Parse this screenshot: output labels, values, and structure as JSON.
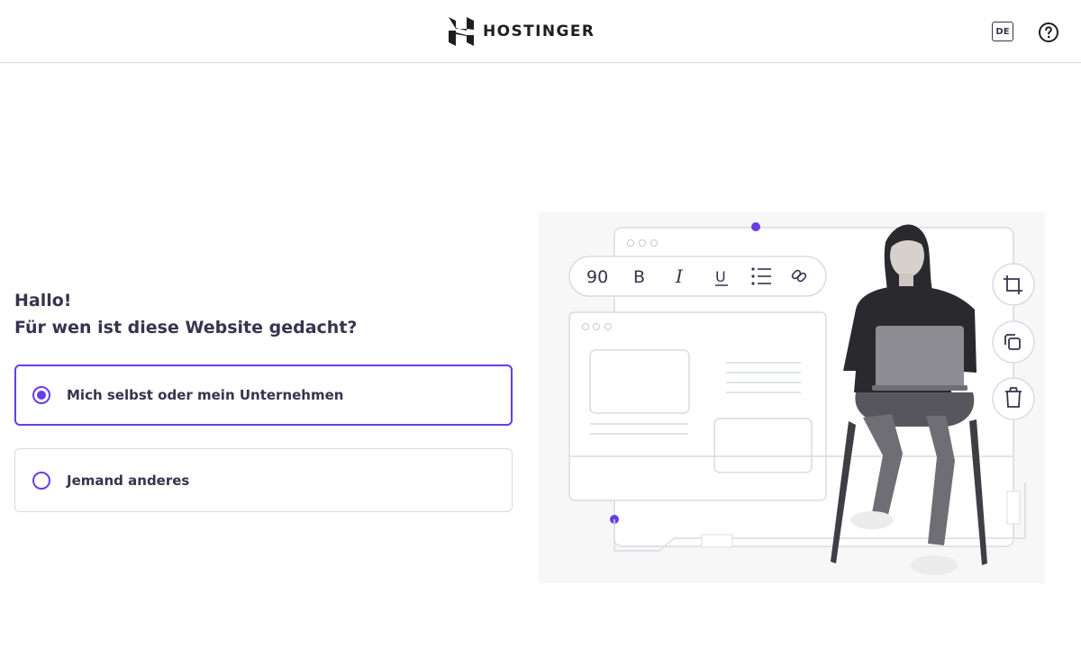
{
  "header": {
    "brand": "HOSTINGER",
    "language": "DE"
  },
  "main": {
    "greeting": "Hallo!",
    "question": "Für wen ist diese Website gedacht?",
    "options": [
      {
        "label": "Mich selbst oder mein Unternehmen",
        "selected": true
      },
      {
        "label": "Jemand anderes",
        "selected": false
      }
    ]
  },
  "illustration": {
    "toolbar_font_size": "90",
    "toolbar_bold": "B",
    "toolbar_italic": "I",
    "toolbar_underline": "U"
  },
  "colors": {
    "accent": "#673de6",
    "text": "#36344d",
    "border": "#dadce0"
  },
  "icons": [
    "hostinger-logo-icon",
    "help-icon",
    "crop-icon",
    "copy-icon",
    "trash-icon",
    "list-icon",
    "link-icon"
  ]
}
